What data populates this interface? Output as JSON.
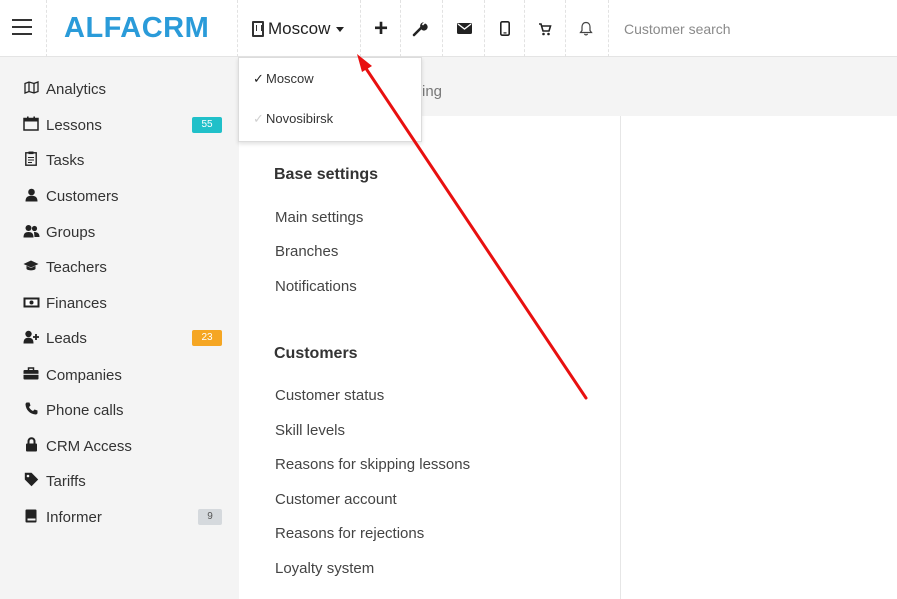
{
  "header": {
    "logo": "ALFACRM",
    "branch": "Moscow",
    "search_placeholder": "Customer search"
  },
  "icons": {
    "menu": "hamburger-menu-icon",
    "branch": "building-icon",
    "add": "plus-icon",
    "settings": "wrench-icon",
    "mail": "envelope-icon",
    "mobile": "mobile-phone-icon",
    "cart": "shopping-cart-icon",
    "notifications": "bell-icon"
  },
  "branch_dropdown": {
    "items": [
      {
        "label": "Moscow",
        "selected": true
      },
      {
        "label": "Novosibirsk",
        "selected": false
      }
    ]
  },
  "sidebar": {
    "items": [
      {
        "label": "Analytics",
        "icon": "map-icon",
        "badge": ""
      },
      {
        "label": "Lessons",
        "icon": "calendar-icon",
        "badge": "55"
      },
      {
        "label": "Tasks",
        "icon": "clipboard-icon",
        "badge": ""
      },
      {
        "label": "Customers",
        "icon": "user-icon",
        "badge": ""
      },
      {
        "label": "Groups",
        "icon": "users-icon",
        "badge": ""
      },
      {
        "label": "Teachers",
        "icon": "graduation-cap-icon",
        "badge": ""
      },
      {
        "label": "Finances",
        "icon": "money-icon",
        "badge": ""
      },
      {
        "label": "Leads",
        "icon": "user-plus-icon",
        "badge": "23"
      },
      {
        "label": "Companies",
        "icon": "briefcase-icon",
        "badge": ""
      },
      {
        "label": "Phone calls",
        "icon": "phone-icon",
        "badge": ""
      },
      {
        "label": "CRM Access",
        "icon": "lock-icon",
        "badge": ""
      },
      {
        "label": "Tariffs",
        "icon": "tag-icon",
        "badge": ""
      },
      {
        "label": "Informer",
        "icon": "book-icon",
        "badge": "9"
      }
    ]
  },
  "main": {
    "subheader_text": "ing",
    "sections": [
      {
        "title": "Base settings",
        "links": [
          "Main settings",
          "Branches",
          "Notifications"
        ]
      },
      {
        "title": "Customers",
        "links": [
          "Customer status",
          "Skill levels",
          "Reasons for skipping lessons",
          "Customer account",
          "Reasons for rejections",
          "Loyalty system"
        ]
      }
    ]
  },
  "colors": {
    "logo": "#2a9bd9",
    "badge_teal": "#20c0c9",
    "badge_orange": "#f5a623",
    "badge_grey": "#d5d9dd",
    "annotation_arrow": "#e81010"
  }
}
